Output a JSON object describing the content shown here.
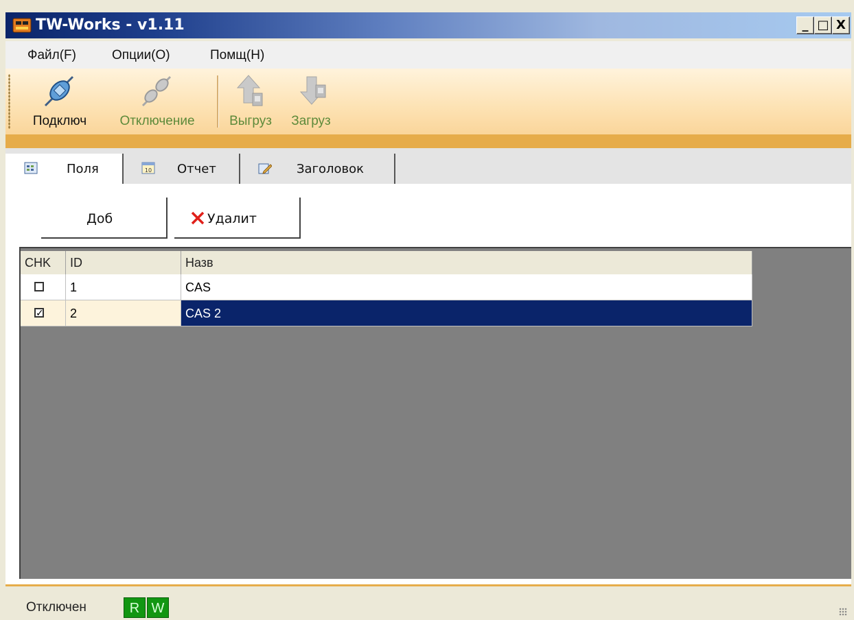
{
  "window": {
    "title": "TW-Works - v1.11",
    "controls": {
      "minimize": "_",
      "maximize": "□",
      "close": "X"
    }
  },
  "menu": {
    "items": [
      {
        "label": "Файл(F)",
        "name": "file"
      },
      {
        "label": "Опции(O)",
        "name": "options"
      },
      {
        "label": "Помщ(H)",
        "name": "help"
      }
    ]
  },
  "toolbar": {
    "connect": "Подключ",
    "disconnect": "Отключение",
    "upload": "Выгруз",
    "download": "Загруз",
    "connect_icon": "plug-connect-icon",
    "disconnect_icon": "plug-disconnect-icon",
    "upload_icon": "upload-arrow-icon",
    "download_icon": "download-arrow-icon"
  },
  "tabs": [
    {
      "label": "Поля",
      "icon": "fields-icon",
      "active": true
    },
    {
      "label": "Отчет",
      "icon": "calendar-icon",
      "active": false
    },
    {
      "label": "Заголовок",
      "icon": "edit-icon",
      "active": false
    }
  ],
  "actions": {
    "add": "Доб",
    "delete": "Удалит"
  },
  "grid": {
    "columns": [
      "CHK",
      "ID",
      "Назв"
    ],
    "rows": [
      {
        "checked": false,
        "id": "1",
        "name": "CAS",
        "selected": false
      },
      {
        "checked": true,
        "id": "2",
        "name": "CAS 2",
        "selected": true
      }
    ]
  },
  "status": {
    "text": "Отключен",
    "read": "R",
    "write": "W"
  },
  "colors": {
    "accent_orange": "#e6ac4a",
    "selection": "#0a246a",
    "rw_green": "#129612"
  }
}
